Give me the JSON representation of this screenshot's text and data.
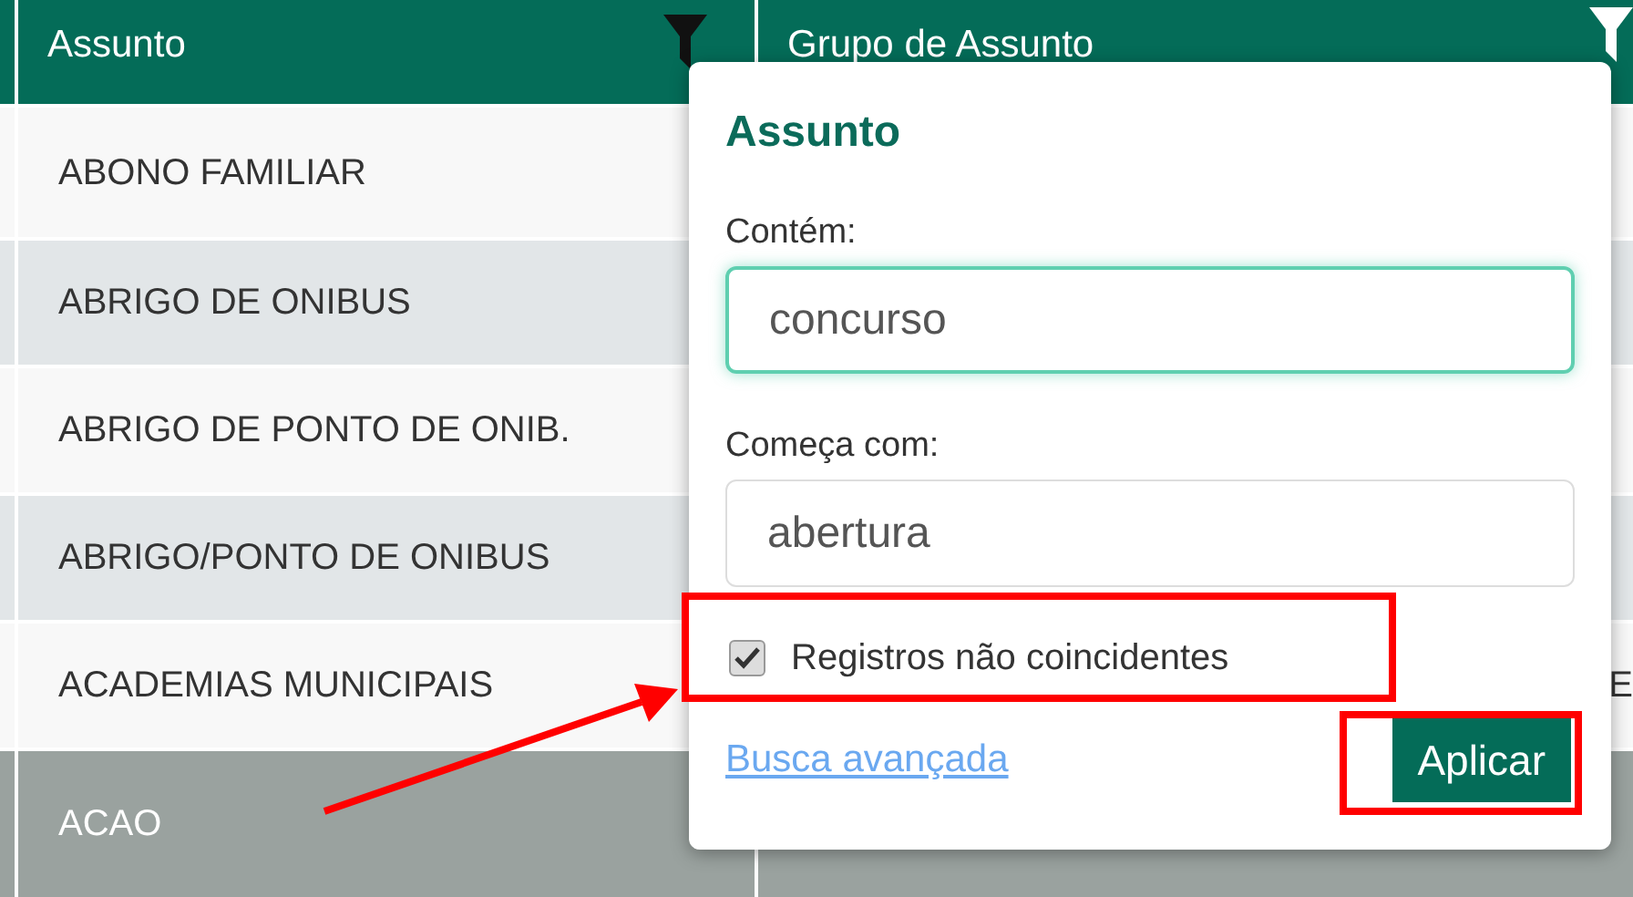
{
  "table": {
    "columns": [
      {
        "label": "Assunto",
        "filter_active": true
      },
      {
        "label": "Grupo de Assunto",
        "filter_active": false
      }
    ],
    "rows": [
      {
        "cells": [
          "ABONO FAMILIAR",
          ""
        ],
        "selected": false
      },
      {
        "cells": [
          "ABRIGO DE ONIBUS",
          ""
        ],
        "selected": false
      },
      {
        "cells": [
          "ABRIGO DE PONTO DE ONIB.",
          ""
        ],
        "selected": false
      },
      {
        "cells": [
          "ABRIGO/PONTO DE ONIBUS",
          ""
        ],
        "selected": false
      },
      {
        "cells": [
          "ACADEMIAS MUNICIPAIS",
          "E"
        ],
        "selected": false
      },
      {
        "cells": [
          "ACAO",
          ""
        ],
        "selected": true
      }
    ]
  },
  "filter_popup": {
    "title": "Assunto",
    "fields": [
      {
        "label": "Contém:",
        "value": "concurso",
        "focused": true
      },
      {
        "label": "Começa com:",
        "value": "abertura",
        "focused": false
      }
    ],
    "checkbox": {
      "label": "Registros não coincidentes",
      "checked": true
    },
    "link": "Busca avançada",
    "apply_button": "Aplicar"
  }
}
